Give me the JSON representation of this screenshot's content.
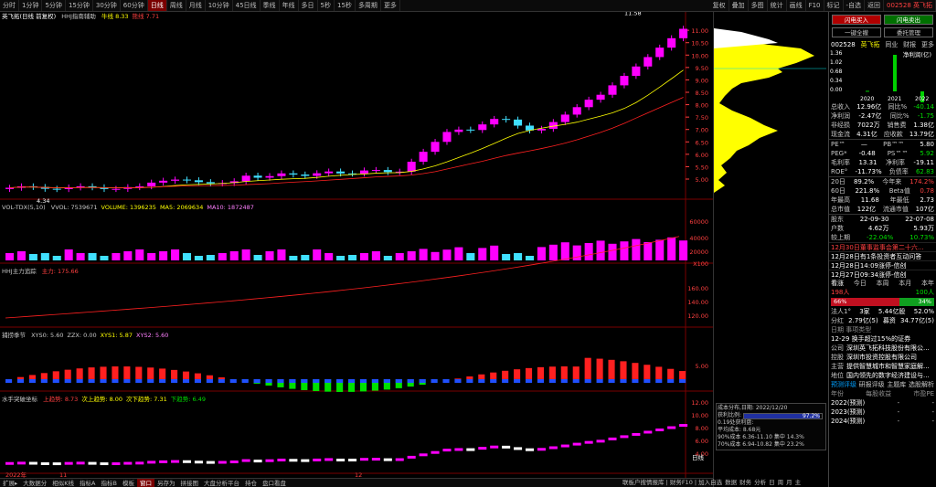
{
  "toolbar": {
    "periods": [
      "分时",
      "1分钟",
      "5分钟",
      "15分钟",
      "30分钟",
      "60分钟",
      "日线",
      "周线",
      "月线",
      "10分钟",
      "45日线",
      "季线",
      "年线",
      "多日",
      "更多"
    ],
    "period_extra": [
      "5秒",
      "15秒",
      "多周期"
    ],
    "active_period": "日线",
    "right_items": [
      "复权",
      "叠加",
      "多图",
      "统计",
      "画线",
      "F10",
      "标记",
      "-自选",
      "返回"
    ],
    "stock": "002528 英飞拓"
  },
  "panels": {
    "main_title": "英飞拓(日线 前复权)",
    "main_indicator": "HHJ指南辅助",
    "main_indicator_vals": [
      {
        "t": "牛线 8.33",
        "c": "#ffff00"
      },
      {
        "t": "熊线 7.71",
        "c": "#ff4040"
      }
    ],
    "price_axis": [
      "11.00",
      "10.50",
      "10.00",
      "9.50",
      "9.00",
      "8.50",
      "8.00",
      "7.50",
      "7.00",
      "6.50",
      "6.00",
      "5.50",
      "5.00"
    ],
    "high_label": "11.58",
    "low_label": "4.34",
    "vol_title": "VOL-TDX(5,10)",
    "vol_vals": [
      {
        "t": "VVOL: 7539671",
        "c": "#c8c8c8"
      },
      {
        "t": "VOLUME: 1396235",
        "c": "#ffff00"
      },
      {
        "t": "MA5: 2069634",
        "c": "#ffff00"
      },
      {
        "t": "MA10: 1872487",
        "c": "#ff80ff"
      }
    ],
    "vol_axis": [
      "60000",
      "40000",
      "20000",
      "X100"
    ],
    "hhj_title": "HHJ主力追踪",
    "hhj_vals": [
      {
        "t": "主力: 175.66",
        "c": "#ff4040"
      }
    ],
    "hhj_axis": [
      "160.00",
      "140.00",
      "120.00"
    ],
    "season_title": "捕捞季节",
    "season_vals": [
      {
        "t": "XYS0: 5.60",
        "c": "#c8c8c8"
      },
      {
        "t": "ZZX: 0.00",
        "c": "#c8c8c8"
      },
      {
        "t": "XYS1: 5.87",
        "c": "#ffff00"
      },
      {
        "t": "XYS2: 5.60",
        "c": "#ff80ff"
      }
    ],
    "season_axis": [
      "5.00"
    ],
    "water_title": "水手突破坐标",
    "water_vals": [
      {
        "t": "上趋势: 8.73",
        "c": "#ff4040"
      },
      {
        "t": "次上趋势: 8.00",
        "c": "#ffff00"
      },
      {
        "t": "次下趋势: 7.31",
        "c": "#ffff00"
      },
      {
        "t": "下趋势: 6.49",
        "c": "#00e000"
      }
    ],
    "water_axis": [
      "12.00",
      "10.00",
      "8.00",
      "6.00",
      "4.00"
    ],
    "date_labels": [
      "2022年",
      "11",
      "12"
    ],
    "day_marker": "日线"
  },
  "bottom_tabs": [
    "指标A",
    "指标B",
    "模板",
    "窗口",
    "另存为",
    "拼接图",
    "大盘分析平台",
    "持仓",
    "盘口看盘"
  ],
  "bottom_active": "窗口",
  "bottom_right": [
    "数据",
    "财务",
    "分析",
    "日",
    "周",
    "月",
    "主"
  ],
  "bottom_left": [
    "扩展▸",
    "大数据分",
    "相似K线"
  ],
  "bottom_notice": "联板户搜情报库 | 财务F10 | 加入自选",
  "volume_profile": {
    "title": "成本分布,日期: 2022/12/20",
    "profit_label": "获利比例:",
    "profit_value": "97.2%",
    "profit_note": "0.19处获利盘:",
    "avg_cost": "平均成本: 8.68元",
    "range90": "90%成本 6.36-11.10 集中 14.3%",
    "range70": "70%成本 6.94-10.82 集中 23.2%"
  },
  "right_panel": {
    "top_btns": [
      "闪电买入",
      "闪电卖出",
      "一键全撤",
      "委托管理"
    ],
    "code": "002528",
    "name": "英飞拓",
    "tabs": [
      "同业",
      "财报",
      "更多"
    ],
    "mini_chart_title": "净利润(亿)",
    "mini_y": [
      "1.36",
      "1.02",
      "0.68",
      "0.34",
      "0.00"
    ],
    "mini_x": [
      "2020",
      "2021",
      "2022"
    ],
    "mini_values": [
      0.02,
      1.36,
      -0.6
    ],
    "fin": [
      {
        "l": "总收入",
        "v": "12.96亿",
        "l2": "同比%",
        "v2": "-40.14",
        "c2": "grn"
      },
      {
        "l": "净利润",
        "v": "-2.47亿",
        "l2": "同比%",
        "v2": "-1.75",
        "c2": "grn"
      },
      {
        "l": "非经损",
        "v": "7022万",
        "l2": "销售费",
        "v2": "1.38亿",
        "c2": "wht"
      },
      {
        "l": "现金流",
        "v": "4.31亿",
        "l2": "应收款",
        "v2": "13.79亿",
        "c2": "wht"
      }
    ],
    "ratios": [
      {
        "l": "PE™",
        "v": "—",
        "l2": "PB™™",
        "v2": "5.80",
        "c": "wht"
      },
      {
        "l": "PEG*",
        "v": "-0.48",
        "l2": "PS™™",
        "v2": "5.92",
        "c": "grn"
      },
      {
        "l": "毛利率",
        "v": "13.31",
        "l2": "净利率",
        "v2": "-19.11",
        "c": "wht"
      },
      {
        "l": "ROE°",
        "v": "-11.73%",
        "l2": "负债率",
        "v2": "62.83",
        "c": "grn"
      }
    ],
    "perf": [
      {
        "l": "20日",
        "v": "89.2%",
        "l2": "今年来",
        "v2": "174.2%",
        "c": "red"
      },
      {
        "l": "60日",
        "v": "221.8%",
        "l2": "Beta值",
        "v2": "0.78",
        "c": "red"
      },
      {
        "l": "年最高",
        "v": "11.68",
        "l2": "年最低",
        "v2": "2.73",
        "c": "wht"
      },
      {
        "l": "总市值",
        "v": "122亿",
        "l2": "流通市值",
        "v2": "107亿",
        "c": "wht"
      }
    ],
    "holders": [
      {
        "l": "股东",
        "v": "22-09-30",
        "v2": "22-07-08",
        "c": "wht"
      },
      {
        "l": "户数",
        "v": "4.62万",
        "v2": "5.93万",
        "c": "wht"
      },
      {
        "l": "较上期",
        "v": "-22.04%",
        "v2": "10.73%",
        "c": "grn"
      }
    ],
    "news": [
      {
        "t": "12月30日董事监事会第二十六...",
        "c": "red"
      },
      {
        "t": "12月28日有1条投资者互动问答",
        "c": "wht"
      },
      {
        "t": "12月28日14:09涨停-信创",
        "c": "wht"
      },
      {
        "t": "12月27日09:34涨停-信创",
        "c": "wht"
      }
    ],
    "sentiment": {
      "label": "看涨",
      "tabs": [
        "今日",
        "本周",
        "本月",
        "本年"
      ],
      "bull_count": "198人",
      "bear_count": "100人",
      "bull_pct": "66%",
      "bear_pct": "34%"
    },
    "inst": [
      {
        "l": "法人1°",
        "m": "3家",
        "v": "5.44亿股",
        "v2": "52.0%"
      },
      {
        "l": "分红",
        "m": "2.79亿(5)",
        "v": "募资",
        "v2": "34.77亿(5)"
      }
    ],
    "event_title": "日期      事项类型",
    "event": "12-29   换手超过15%的证券",
    "profile": [
      {
        "l": "公司",
        "v": "深圳英飞拓科技股份有限公..."
      },
      {
        "l": "控股",
        "v": "深圳市投资控股有限公司"
      },
      {
        "l": "主营",
        "v": "提供智慧城市和智慧家庭解..."
      },
      {
        "l": "地位",
        "v": "国内领先的数字经济建设与..."
      }
    ],
    "forecast_tabs": [
      "预测评级",
      "研报评级",
      "主题库",
      "选股解析"
    ],
    "forecast_cols": [
      "年份",
      "每股收益",
      "市盈PE"
    ],
    "forecast_rows": [
      "2022(预测)",
      "2023(预测)",
      "2024(预测)"
    ]
  },
  "colors": {
    "up": "#ff00ff",
    "down": "#40e0ff",
    "red": "#ff2020",
    "yellow": "#ffff00"
  }
}
